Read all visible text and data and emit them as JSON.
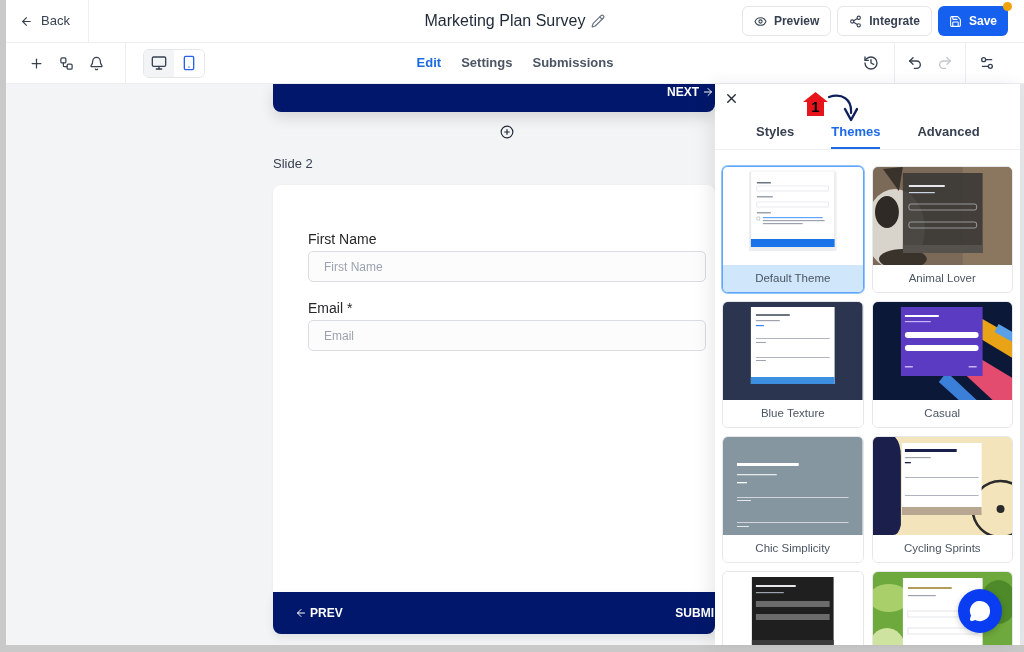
{
  "header": {
    "back_label": "Back",
    "title": "Marketing Plan Survey",
    "actions": [
      {
        "kind": "preview",
        "label": "Preview"
      },
      {
        "kind": "integrate",
        "label": "Integrate"
      },
      {
        "kind": "save",
        "label": "Save",
        "unsaved": true
      }
    ]
  },
  "toolbar": {
    "devices": [
      {
        "kind": "desktop",
        "selected": false
      },
      {
        "kind": "mobile",
        "selected": true
      }
    ],
    "tabs": [
      {
        "label": "Edit",
        "selected": true
      },
      {
        "label": "Settings",
        "selected": false
      },
      {
        "label": "Submissions",
        "selected": false
      }
    ],
    "history": [
      {
        "kind": "undo",
        "disabled": false
      },
      {
        "kind": "redo",
        "disabled": true
      }
    ]
  },
  "canvas": {
    "previous_slide": {
      "next_label": "NEXT"
    },
    "slide": {
      "title": "Slide 2",
      "fields": [
        {
          "label": "First Name",
          "placeholder": "First Name"
        },
        {
          "label": "Email *",
          "placeholder": "Email"
        }
      ],
      "prev_label": "PREV",
      "submit_label": "SUBMI"
    }
  },
  "panel": {
    "annotation": "1",
    "tabs": [
      {
        "label": "Styles",
        "selected": false
      },
      {
        "label": "Themes",
        "selected": true
      },
      {
        "label": "Advanced",
        "selected": false
      }
    ],
    "themes": [
      {
        "kind": "default",
        "name": "Default Theme",
        "selected": true
      },
      {
        "kind": "animal",
        "name": "Animal Lover",
        "selected": false
      },
      {
        "kind": "blue_texture",
        "name": "Blue Texture",
        "selected": false
      },
      {
        "kind": "casual",
        "name": "Casual",
        "selected": false
      },
      {
        "kind": "chic",
        "name": "Chic Simplicity",
        "selected": false
      },
      {
        "kind": "cycling",
        "name": "Cycling Sprints",
        "selected": false
      },
      {
        "kind": "dark",
        "selected": false
      },
      {
        "kind": "leaf",
        "selected": false
      }
    ]
  }
}
